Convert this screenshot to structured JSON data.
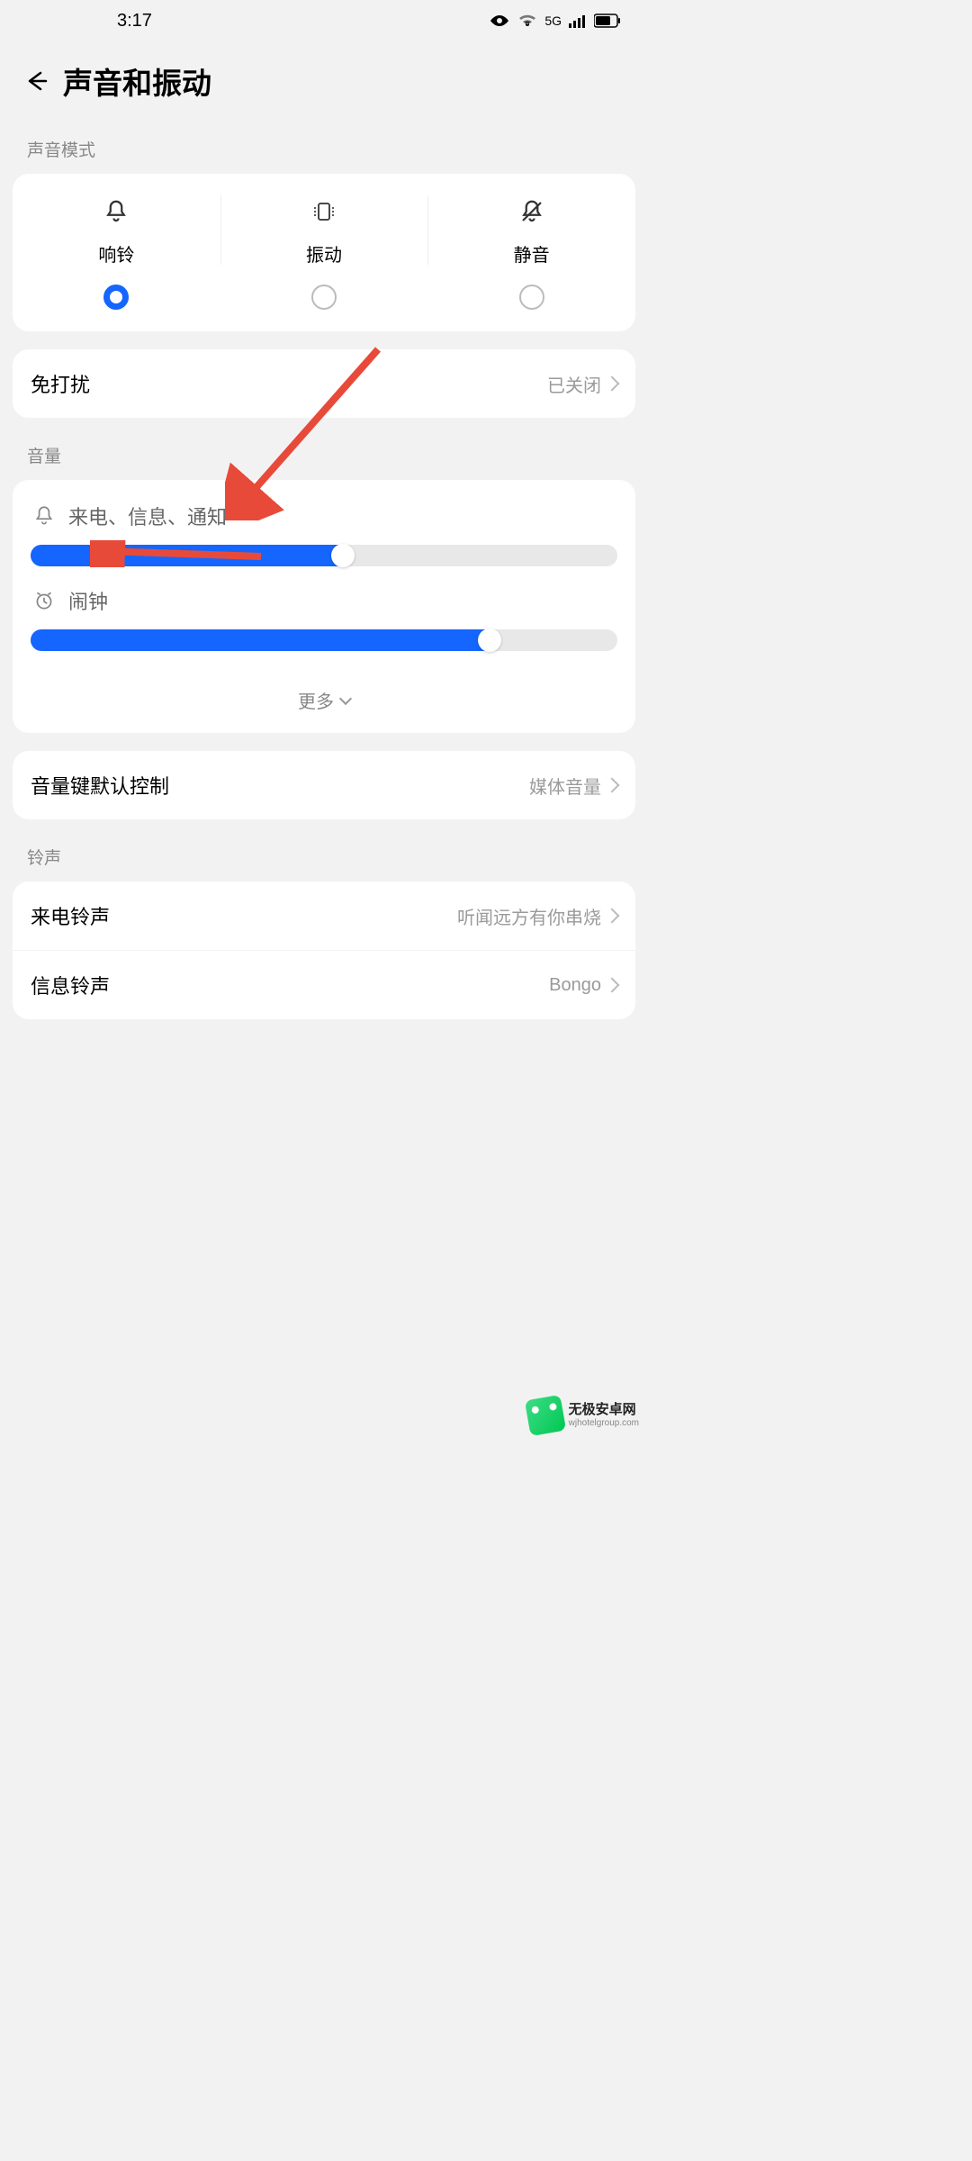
{
  "status": {
    "time": "3:17",
    "network": "5G"
  },
  "header": {
    "title": "声音和振动"
  },
  "sections": {
    "sound_mode": {
      "label": "声音模式",
      "options": [
        {
          "label": "响铃",
          "icon": "bell-icon",
          "selected": true
        },
        {
          "label": "振动",
          "icon": "vibrate-icon",
          "selected": false
        },
        {
          "label": "静音",
          "icon": "mute-icon",
          "selected": false
        }
      ]
    },
    "dnd": {
      "title": "免打扰",
      "value": "已关闭"
    },
    "volume": {
      "label": "音量",
      "ringtone": {
        "label": "来电、信息、通知",
        "percent": 55
      },
      "alarm": {
        "label": "闹钟",
        "percent": 80
      },
      "more": "更多"
    },
    "volume_key": {
      "title": "音量键默认控制",
      "value": "媒体音量"
    },
    "ringtones": {
      "label": "铃声",
      "incoming": {
        "title": "来电铃声",
        "value": "听闻远方有你串烧"
      },
      "message": {
        "title": "信息铃声",
        "value": "Bongo"
      }
    }
  },
  "watermark": {
    "cn": "无极安卓网",
    "en": "wjhotelgroup.com"
  }
}
